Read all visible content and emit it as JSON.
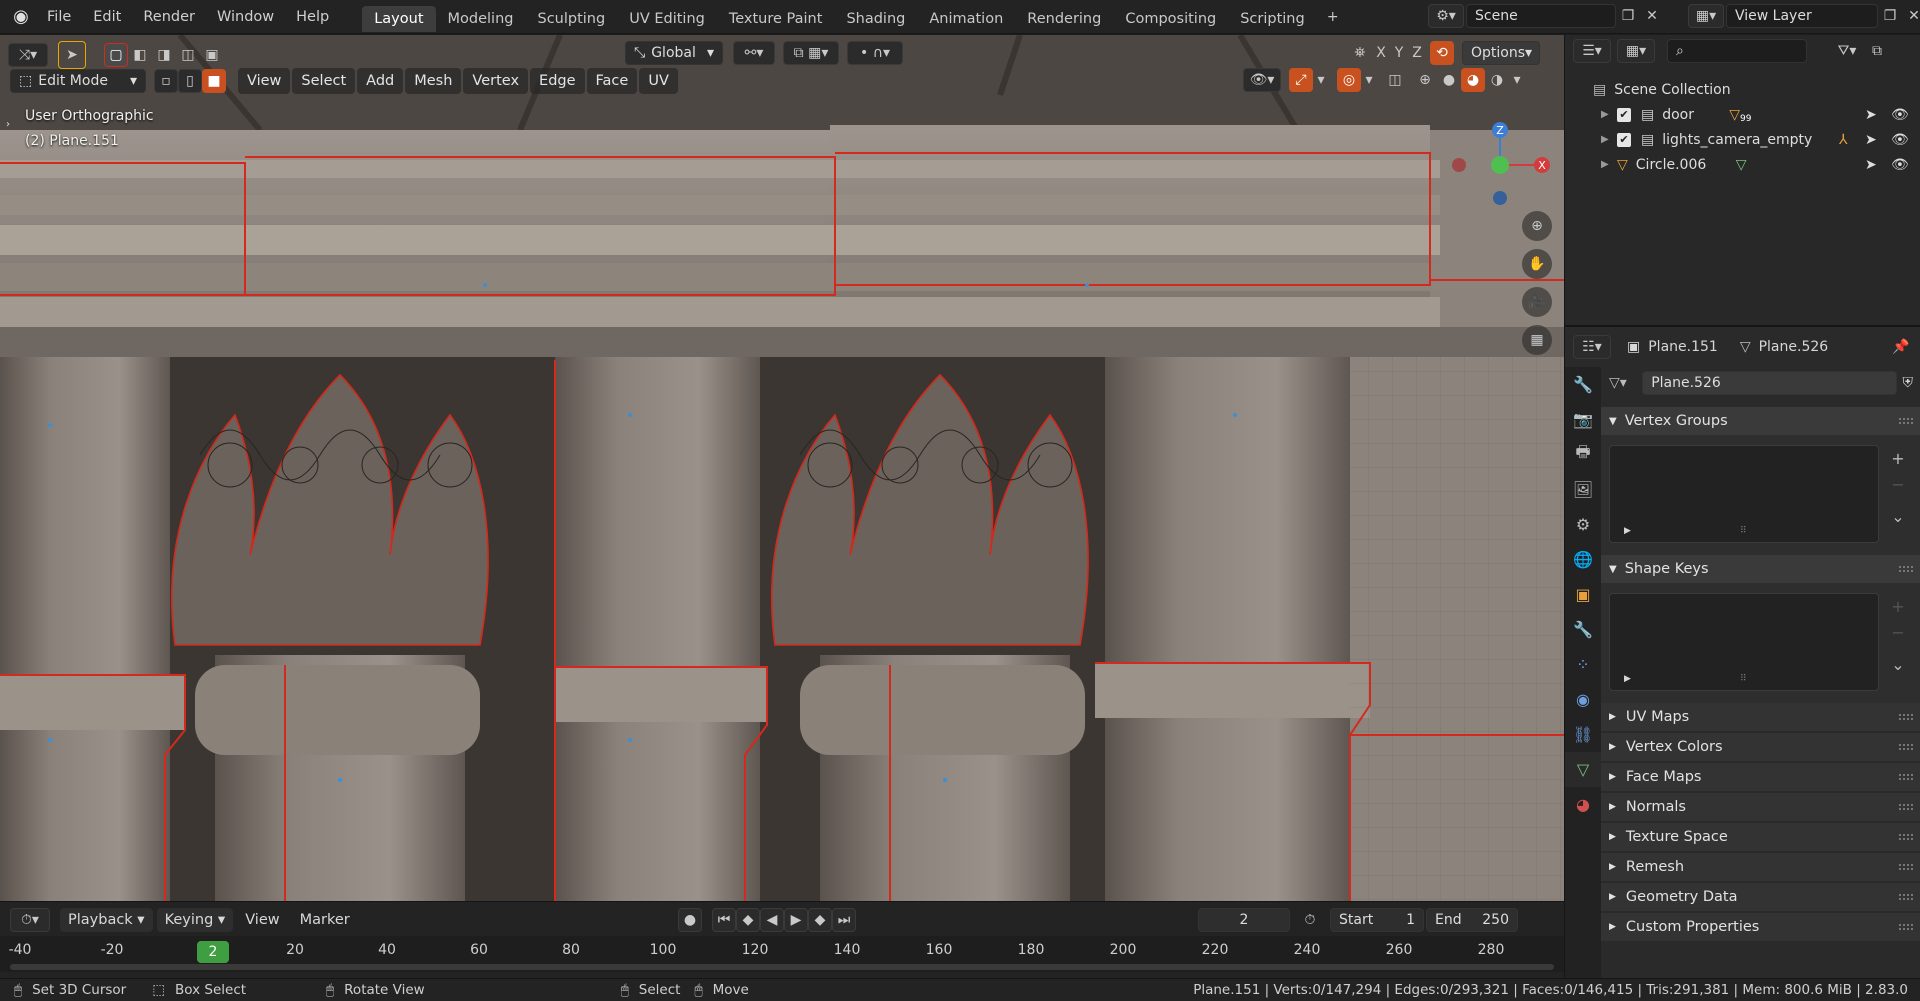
{
  "topbar": {
    "menus": [
      "File",
      "Edit",
      "Render",
      "Window",
      "Help"
    ],
    "workspaces": [
      "Layout",
      "Modeling",
      "Sculpting",
      "UV Editing",
      "Texture Paint",
      "Shading",
      "Animation",
      "Rendering",
      "Compositing",
      "Scripting"
    ],
    "active_workspace": "Layout",
    "scene_name": "Scene",
    "view_layer": "View Layer"
  },
  "toolbar": {
    "orientation": "Global",
    "options_label": "Options",
    "axes": [
      "X",
      "Y",
      "Z"
    ]
  },
  "viewport": {
    "mode": "Edit Mode",
    "menus": [
      "View",
      "Select",
      "Add",
      "Mesh",
      "Vertex",
      "Edge",
      "Face",
      "UV"
    ],
    "view_name": "User Orthographic",
    "object_label": "(2) Plane.151",
    "gizmo_axes": {
      "x": "X",
      "y": "Y",
      "z": "Z"
    }
  },
  "timeline": {
    "menus": [
      "Playback",
      "Keying",
      "View",
      "Marker"
    ],
    "current_frame": "2",
    "start_label": "Start",
    "start_value": "1",
    "end_label": "End",
    "end_value": "250",
    "ticks": [
      "-40",
      "-20",
      "20",
      "40",
      "60",
      "80",
      "100",
      "120",
      "140",
      "160",
      "180",
      "200",
      "220",
      "240",
      "260",
      "280"
    ],
    "current_marker": "2"
  },
  "statusbar": {
    "left": [
      "Set 3D Cursor",
      "Box Select",
      "Rotate View"
    ],
    "middle": [
      "Select",
      "Move"
    ],
    "stats": "Plane.151 | Verts:0/147,294 | Edges:0/293,321 | Faces:0/146,415 | Tris:291,381 | Mem: 800.6 MiB | 2.83.0"
  },
  "outliner": {
    "root": "Scene Collection",
    "items": [
      {
        "name": "door",
        "badge": "99"
      },
      {
        "name": "lights_camera_empty"
      },
      {
        "name": "Circle.006"
      }
    ]
  },
  "properties": {
    "object_name": "Plane.151",
    "mesh_name": "Plane.526",
    "data_field": "Plane.526",
    "panels_open": [
      "Vertex Groups",
      "Shape Keys"
    ],
    "panels_closed": [
      "UV Maps",
      "Vertex Colors",
      "Face Maps",
      "Normals",
      "Texture Space",
      "Remesh",
      "Geometry Data",
      "Custom Properties"
    ]
  },
  "colors": {
    "accent": "#4772b3",
    "orange": "#c9511f",
    "edit_edge": "#d4291c",
    "timeline_marker": "#3f9e3f"
  }
}
